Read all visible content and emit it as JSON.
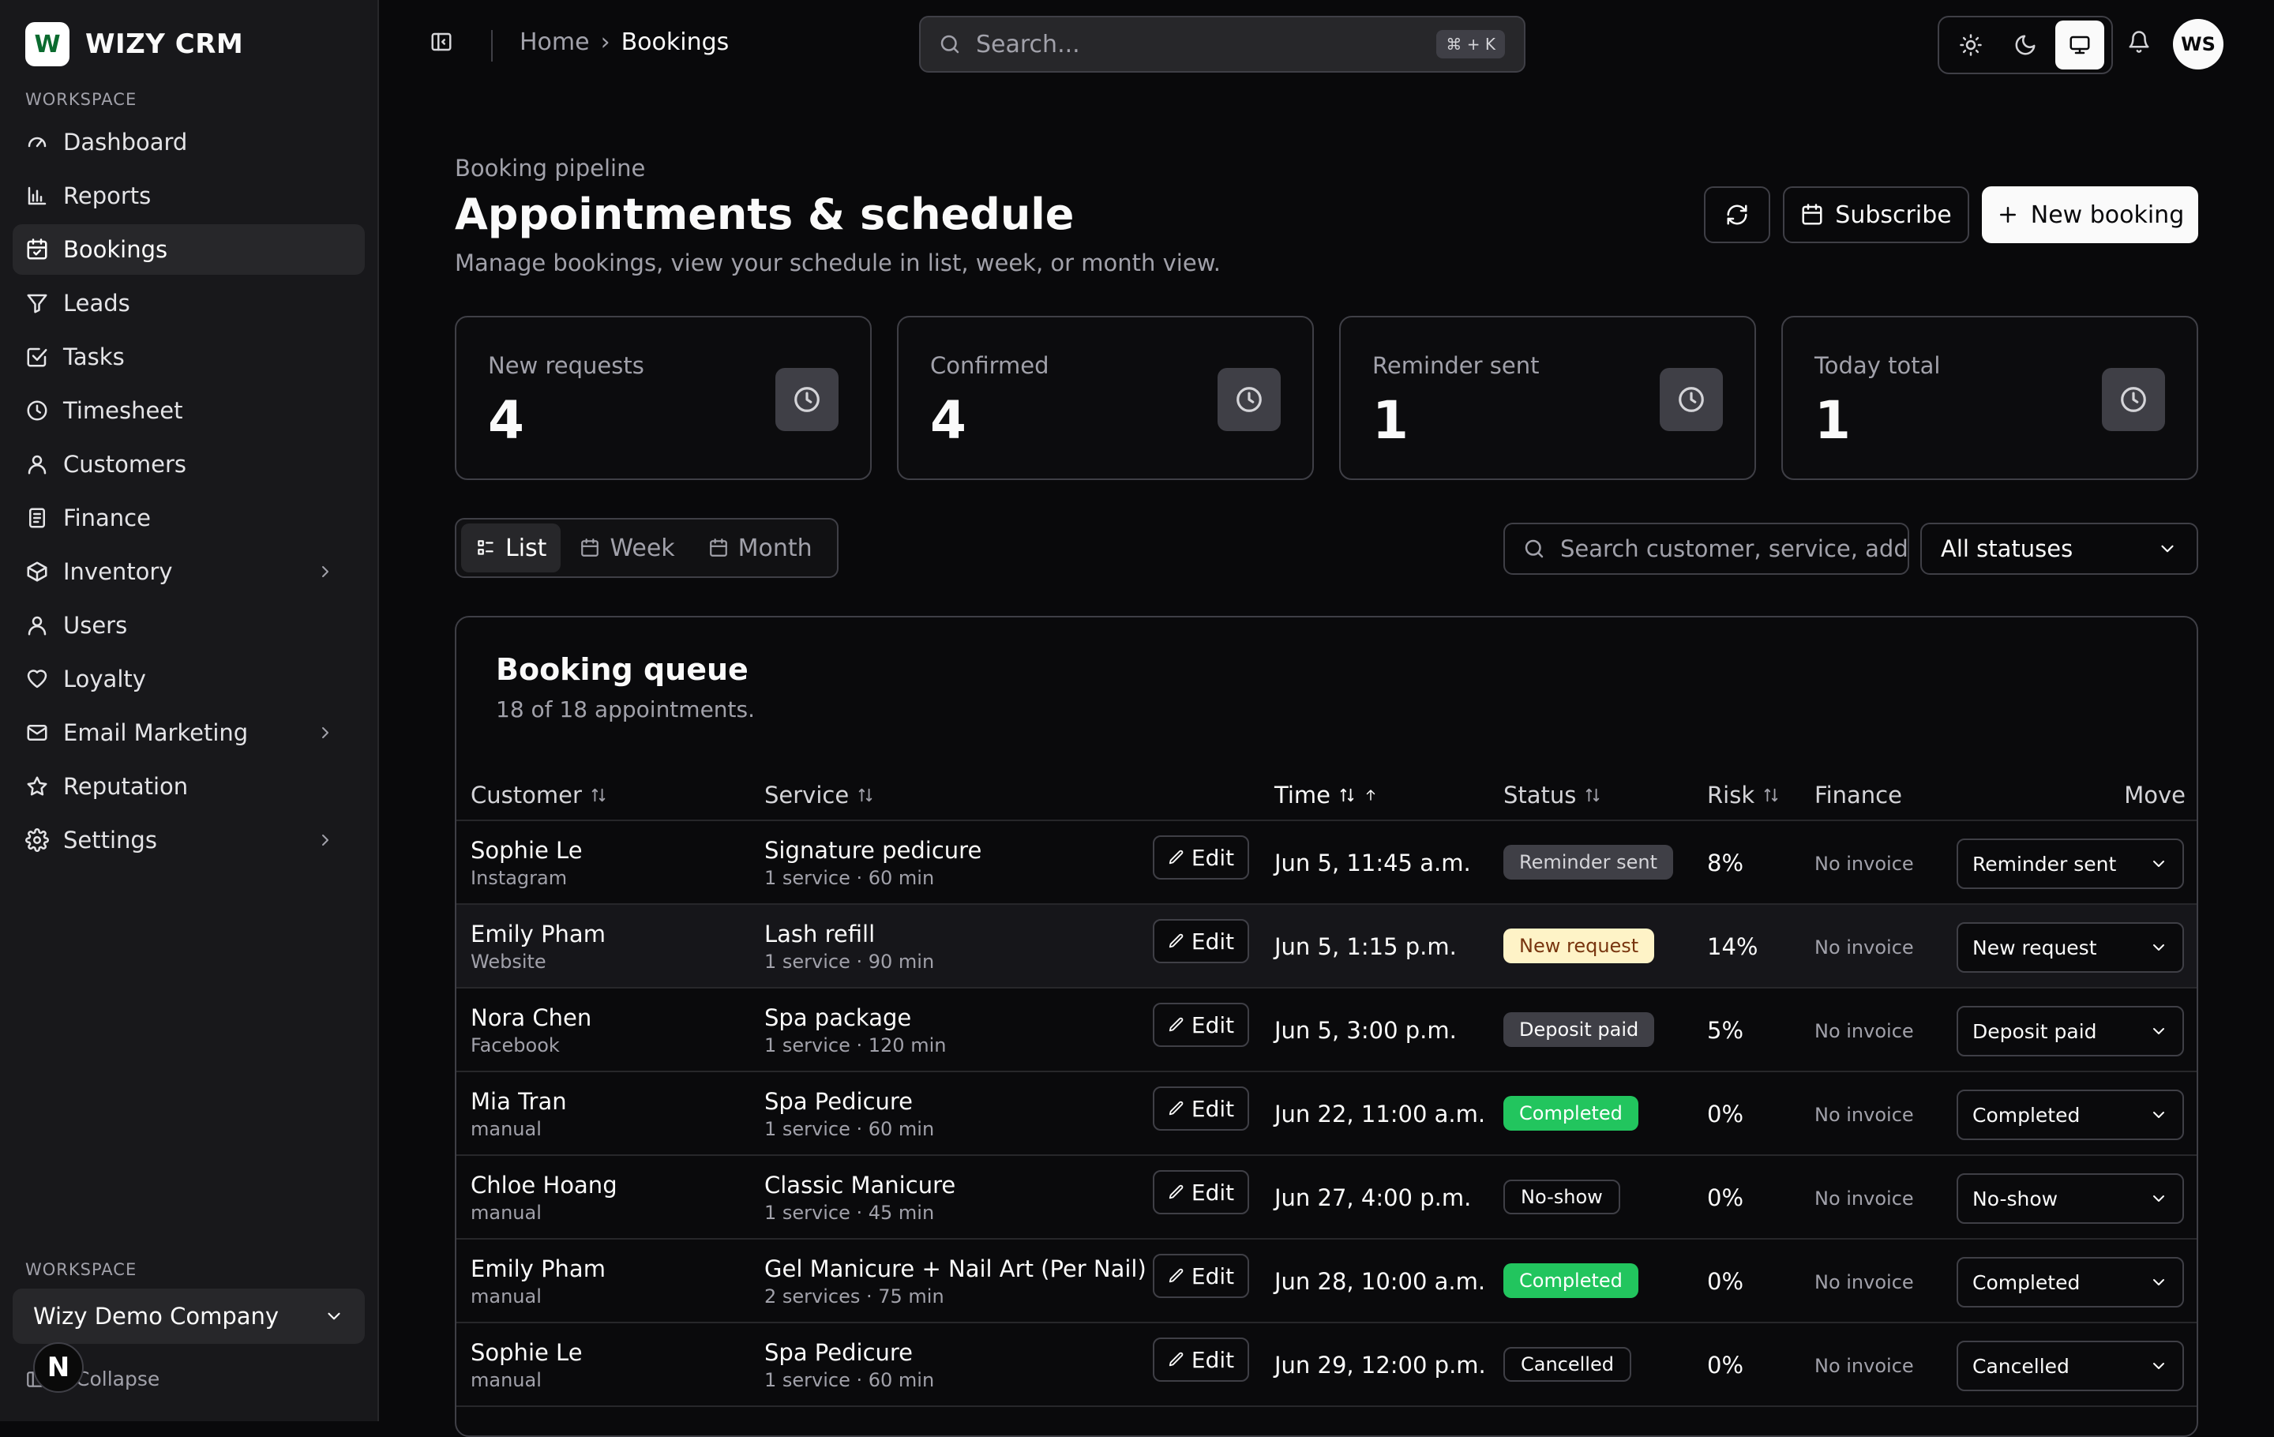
{
  "app": {
    "name": "WIZY CRM",
    "logo_letter": "W"
  },
  "sidebar": {
    "section_label": "WORKSPACE",
    "items": [
      {
        "label": "Dashboard",
        "icon": "gauge-icon",
        "active": false,
        "has_submenu": false
      },
      {
        "label": "Reports",
        "icon": "bar-chart-icon",
        "active": false,
        "has_submenu": false
      },
      {
        "label": "Bookings",
        "icon": "calendar-icon",
        "active": true,
        "has_submenu": false
      },
      {
        "label": "Leads",
        "icon": "funnel-icon",
        "active": false,
        "has_submenu": false
      },
      {
        "label": "Tasks",
        "icon": "checkbox-icon",
        "active": false,
        "has_submenu": false
      },
      {
        "label": "Timesheet",
        "icon": "clock-icon",
        "active": false,
        "has_submenu": false
      },
      {
        "label": "Customers",
        "icon": "user-icon",
        "active": false,
        "has_submenu": false
      },
      {
        "label": "Finance",
        "icon": "document-icon",
        "active": false,
        "has_submenu": false
      },
      {
        "label": "Inventory",
        "icon": "box-icon",
        "active": false,
        "has_submenu": true
      },
      {
        "label": "Users",
        "icon": "user-icon",
        "active": false,
        "has_submenu": false
      },
      {
        "label": "Loyalty",
        "icon": "heart-icon",
        "active": false,
        "has_submenu": false
      },
      {
        "label": "Email Marketing",
        "icon": "mail-icon",
        "active": false,
        "has_submenu": true
      },
      {
        "label": "Reputation",
        "icon": "star-icon",
        "active": false,
        "has_submenu": false
      },
      {
        "label": "Settings",
        "icon": "gear-icon",
        "active": false,
        "has_submenu": true
      }
    ],
    "workspace_label": "WORKSPACE",
    "workspace_name": "Wizy Demo Company",
    "collapse_label": "Collapse",
    "badge_letter": "N"
  },
  "topbar": {
    "breadcrumb": [
      "Home",
      "Bookings"
    ],
    "search_placeholder": "Search...",
    "search_shortcut": "⌘ + K",
    "avatar_initials": "WS"
  },
  "header": {
    "eyebrow": "Booking pipeline",
    "title": "Appointments & schedule",
    "subtitle": "Manage bookings, view your schedule in list, week, or month view.",
    "subscribe_label": "Subscribe",
    "new_booking_label": "New booking"
  },
  "stats": [
    {
      "label": "New requests",
      "value": "4"
    },
    {
      "label": "Confirmed",
      "value": "4"
    },
    {
      "label": "Reminder sent",
      "value": "1"
    },
    {
      "label": "Today total",
      "value": "1"
    }
  ],
  "views": [
    {
      "label": "List",
      "active": true
    },
    {
      "label": "Week",
      "active": false
    },
    {
      "label": "Month",
      "active": false
    }
  ],
  "filters": {
    "search_placeholder": "Search customer, service, address",
    "status_value": "All statuses"
  },
  "table": {
    "title": "Booking queue",
    "subtitle": "18 of 18 appointments.",
    "columns": [
      "Customer",
      "Service",
      "Time",
      "Status",
      "Risk",
      "Finance",
      "Move"
    ],
    "edit_label": "Edit",
    "rows": [
      {
        "name": "Sophie Le",
        "source": "Instagram",
        "service": "Signature pedicure",
        "meta": "1 service · 60 min",
        "time": "Jun 5, 11:45 a.m.",
        "status": "Reminder sent",
        "status_bg": "#3f3f46",
        "status_fg": "#d4d4d8",
        "risk": "8%",
        "finance": "No invoice",
        "move": "Reminder sent",
        "highlight": false
      },
      {
        "name": "Emily Pham",
        "source": "Website",
        "service": "Lash refill",
        "meta": "1 service · 90 min",
        "time": "Jun 5, 1:15 p.m.",
        "status": "New request",
        "status_bg": "#fef3c7",
        "status_fg": "#78350f",
        "risk": "14%",
        "finance": "No invoice",
        "move": "New request",
        "highlight": true
      },
      {
        "name": "Nora Chen",
        "source": "Facebook",
        "service": "Spa package",
        "meta": "1 service · 120 min",
        "time": "Jun 5, 3:00 p.m.",
        "status": "Deposit paid",
        "status_bg": "#3f3f46",
        "status_fg": "#fafafa",
        "risk": "5%",
        "finance": "No invoice",
        "move": "Deposit paid",
        "highlight": false
      },
      {
        "name": "Mia Tran",
        "source": "manual",
        "service": "Spa Pedicure",
        "meta": "1 service · 60 min",
        "time": "Jun 22, 11:00 a.m.",
        "status": "Completed",
        "status_bg": "#22c55e",
        "status_fg": "#ffffff",
        "risk": "0%",
        "finance": "No invoice",
        "move": "Completed",
        "highlight": false
      },
      {
        "name": "Chloe Hoang",
        "source": "manual",
        "service": "Classic Manicure",
        "meta": "1 service · 45 min",
        "time": "Jun 27, 4:00 p.m.",
        "status": "No-show",
        "status_bg": "#09090b",
        "status_fg": "#fafafa",
        "risk": "0%",
        "finance": "No invoice",
        "move": "No-show",
        "highlight": false
      },
      {
        "name": "Emily Pham",
        "source": "manual",
        "service": "Gel Manicure + Nail Art (Per Nail)",
        "meta": "2 services · 75 min",
        "time": "Jun 28, 10:00 a.m.",
        "status": "Completed",
        "status_bg": "#22c55e",
        "status_fg": "#ffffff",
        "risk": "0%",
        "finance": "No invoice",
        "move": "Completed",
        "highlight": false
      },
      {
        "name": "Sophie Le",
        "source": "manual",
        "service": "Spa Pedicure",
        "meta": "1 service · 60 min",
        "time": "Jun 29, 12:00 p.m.",
        "status": "Cancelled",
        "status_bg": "#09090b",
        "status_fg": "#fafafa",
        "risk": "0%",
        "finance": "No invoice",
        "move": "Cancelled",
        "highlight": false
      }
    ]
  }
}
